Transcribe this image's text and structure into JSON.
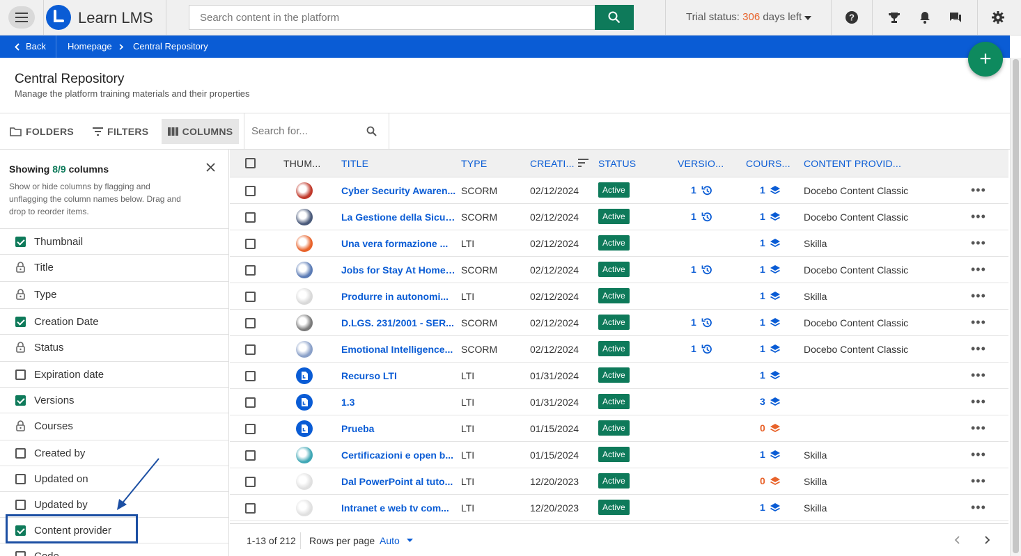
{
  "app": {
    "name": "Learn LMS"
  },
  "search": {
    "placeholder": "Search content in the platform"
  },
  "trial": {
    "label": "Trial status:",
    "days": "306",
    "suffix": "days left"
  },
  "breadcrumb": {
    "back": "Back",
    "home": "Homepage",
    "current": "Central Repository"
  },
  "page": {
    "title": "Central Repository",
    "subtitle": "Manage the platform training materials and their properties"
  },
  "toolbar": {
    "folders": "FOLDERS",
    "filters": "FILTERS",
    "columns": "COLUMNS",
    "search_placeholder": "Search for..."
  },
  "panel": {
    "title_prefix": "Showing",
    "count": "8/9",
    "title_suffix": "columns",
    "description": "Show or hide columns by flagging and unflagging the column names below. Drag and drop to reorder items.",
    "items": [
      {
        "label": "Thumbnail",
        "state": "checked"
      },
      {
        "label": "Title",
        "state": "locked"
      },
      {
        "label": "Type",
        "state": "locked"
      },
      {
        "label": "Creation Date",
        "state": "checked"
      },
      {
        "label": "Status",
        "state": "locked"
      },
      {
        "label": "Expiration date",
        "state": "unchecked"
      },
      {
        "label": "Versions",
        "state": "checked"
      },
      {
        "label": "Courses",
        "state": "locked"
      },
      {
        "label": "Created by",
        "state": "unchecked"
      },
      {
        "label": "Updated on",
        "state": "unchecked"
      },
      {
        "label": "Updated by",
        "state": "unchecked"
      },
      {
        "label": "Content provider",
        "state": "checked"
      },
      {
        "label": "Code",
        "state": "unchecked"
      }
    ]
  },
  "table": {
    "headers": {
      "thumb": "THUM...",
      "title": "TITLE",
      "type": "TYPE",
      "created": "CREATI...",
      "status": "STATUS",
      "versions": "VERSIO...",
      "courses": "COURS...",
      "provider": "CONTENT PROVID..."
    },
    "rows": [
      {
        "title": "Cyber Security Awaren...",
        "type": "SCORM",
        "date": "02/12/2024",
        "status": "Active",
        "versions": "1",
        "courses": "1",
        "courses_warn": false,
        "provider": "Docebo Content Classic",
        "thumb_color": "#c0392b"
      },
      {
        "title": "La Gestione della Sicur...",
        "type": "SCORM",
        "date": "02/12/2024",
        "status": "Active",
        "versions": "1",
        "courses": "1",
        "courses_warn": false,
        "provider": "Docebo Content Classic",
        "thumb_color": "#4a5a7a"
      },
      {
        "title": "Una vera formazione ...",
        "type": "LTI",
        "date": "02/12/2024",
        "status": "Active",
        "versions": "",
        "courses": "1",
        "courses_warn": false,
        "provider": "Skilla",
        "thumb_color": "#e8632b"
      },
      {
        "title": "Jobs for Stay At Home ...",
        "type": "SCORM",
        "date": "02/12/2024",
        "status": "Active",
        "versions": "1",
        "courses": "1",
        "courses_warn": false,
        "provider": "Docebo Content Classic",
        "thumb_color": "#5b7bb5"
      },
      {
        "title": "Produrre in autonomi...",
        "type": "LTI",
        "date": "02/12/2024",
        "status": "Active",
        "versions": "",
        "courses": "1",
        "courses_warn": false,
        "provider": "Skilla",
        "thumb_color": "#d9d9d9"
      },
      {
        "title": "D.LGS. 231/2001 - SER...",
        "type": "SCORM",
        "date": "02/12/2024",
        "status": "Active",
        "versions": "1",
        "courses": "1",
        "courses_warn": false,
        "provider": "Docebo Content Classic",
        "thumb_color": "#7a7a7a"
      },
      {
        "title": "Emotional Intelligence...",
        "type": "SCORM",
        "date": "02/12/2024",
        "status": "Active",
        "versions": "1",
        "courses": "1",
        "courses_warn": false,
        "provider": "Docebo Content Classic",
        "thumb_color": "#8aa0c8"
      },
      {
        "title": "Recurso LTI",
        "type": "LTI",
        "date": "01/31/2024",
        "status": "Active",
        "versions": "",
        "courses": "1",
        "courses_warn": false,
        "provider": "",
        "thumb_color": "#0a5cd5"
      },
      {
        "title": "1.3",
        "type": "LTI",
        "date": "01/31/2024",
        "status": "Active",
        "versions": "",
        "courses": "3",
        "courses_warn": false,
        "provider": "",
        "thumb_color": "#0a5cd5"
      },
      {
        "title": "Prueba",
        "type": "LTI",
        "date": "01/15/2024",
        "status": "Active",
        "versions": "",
        "courses": "0",
        "courses_warn": true,
        "provider": "",
        "thumb_color": "#0a5cd5"
      },
      {
        "title": "Certificazioni e open b...",
        "type": "LTI",
        "date": "01/15/2024",
        "status": "Active",
        "versions": "",
        "courses": "1",
        "courses_warn": false,
        "provider": "Skilla",
        "thumb_color": "#3fa7b5"
      },
      {
        "title": "Dal PowerPoint al tuto...",
        "type": "LTI",
        "date": "12/20/2023",
        "status": "Active",
        "versions": "",
        "courses": "0",
        "courses_warn": true,
        "provider": "Skilla",
        "thumb_color": "#e0e0e0"
      },
      {
        "title": "Intranet e web tv com...",
        "type": "LTI",
        "date": "12/20/2023",
        "status": "Active",
        "versions": "",
        "courses": "1",
        "courses_warn": false,
        "provider": "Skilla",
        "thumb_color": "#e0e0e0"
      }
    ]
  },
  "pagination": {
    "range": "1-13 of 212",
    "rows_label": "Rows per page",
    "rows_value": "Auto"
  }
}
